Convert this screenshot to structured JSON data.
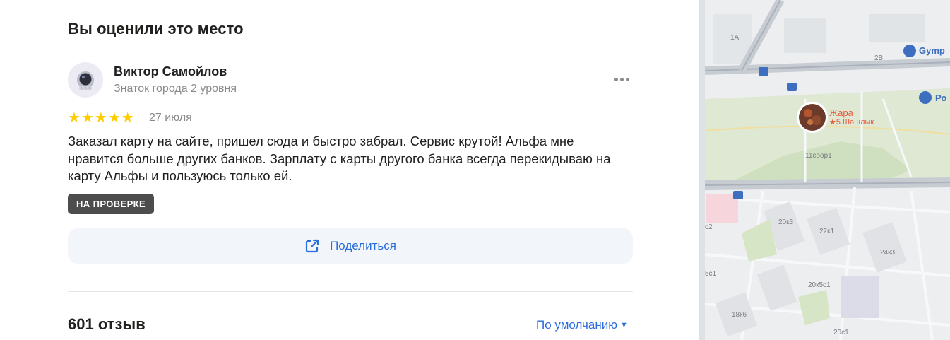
{
  "heading": "Вы оценили это место",
  "review": {
    "author_name": "Виктор Самойлов",
    "author_level": "Знаток города 2 уровня",
    "rating": 5,
    "date": "27 июля",
    "text": "Заказал карту на сайте, пришел сюда и быстро забрал. Сервис крутой! Альфа мне нравится больше других банков. Зарплату с карты другого банка всегда перекидываю на карту Альфы и пользуюсь только ей.",
    "status_badge": "НА ПРОВЕРКЕ"
  },
  "share_label": "Поделиться",
  "reviews_count": "601 отзыв",
  "sort_label": "По умолчанию",
  "colors": {
    "accent": "#2a6ddc",
    "star": "#ffcc00",
    "badge_bg": "#4d4d4d",
    "poi": "#e8583c"
  },
  "map": {
    "poi": {
      "name": "Жара",
      "rating_category": "★5 Шашлык"
    },
    "brand_labels": [
      "Gymp",
      "Ро"
    ],
    "building_labels": [
      "1А",
      "2В",
      "11соор1",
      "20к3",
      "22к1",
      "24к3",
      "20к5с1",
      "18к6",
      "20с1",
      "5с1",
      "с2"
    ]
  }
}
